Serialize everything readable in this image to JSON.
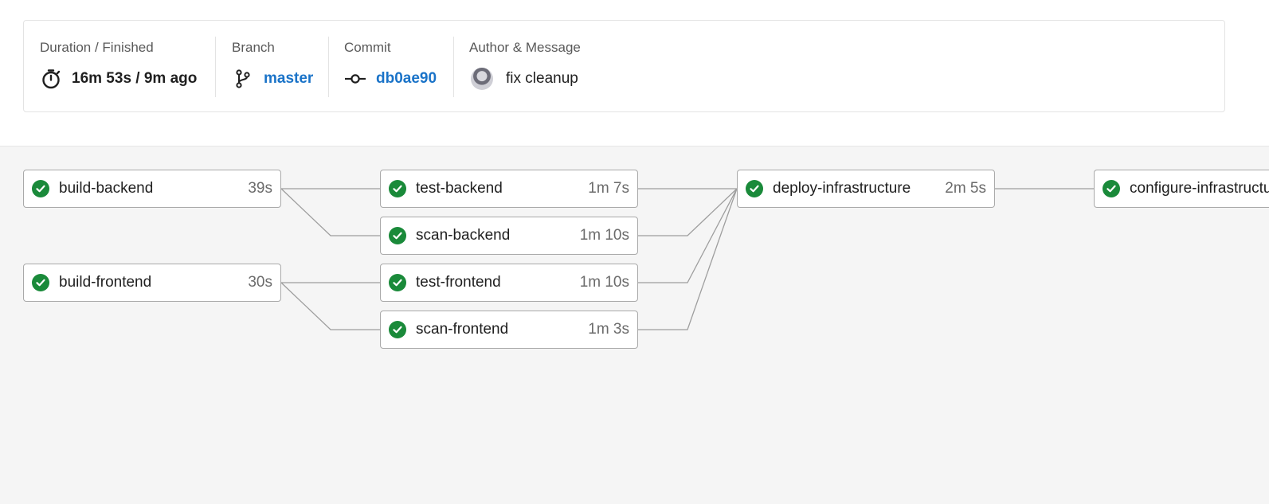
{
  "summary": {
    "duration": {
      "label": "Duration / Finished",
      "value": "16m 53s / 9m ago",
      "icon": "stopwatch-icon"
    },
    "branch": {
      "label": "Branch",
      "value": "master",
      "icon": "branch-icon"
    },
    "commit": {
      "label": "Commit",
      "value": "db0ae90",
      "icon": "commit-icon"
    },
    "author": {
      "label": "Author & Message",
      "message": "fix cleanup",
      "icon": "avatar"
    }
  },
  "colors": {
    "success": "#1a8a3a",
    "link": "#1a73c8",
    "graph_background": "#f5f5f5"
  },
  "pipeline": {
    "jobs": [
      {
        "name": "build-backend",
        "duration": "39s",
        "status": "success"
      },
      {
        "name": "build-frontend",
        "duration": "30s",
        "status": "success"
      },
      {
        "name": "test-backend",
        "duration": "1m 7s",
        "status": "success"
      },
      {
        "name": "scan-backend",
        "duration": "1m 10s",
        "status": "success"
      },
      {
        "name": "test-frontend",
        "duration": "1m 10s",
        "status": "success"
      },
      {
        "name": "scan-frontend",
        "duration": "1m 3s",
        "status": "success"
      },
      {
        "name": "deploy-infrastructure",
        "duration": "2m 5s",
        "status": "success"
      },
      {
        "name": "configure-infrastructure",
        "duration": "",
        "status": "success"
      }
    ]
  }
}
